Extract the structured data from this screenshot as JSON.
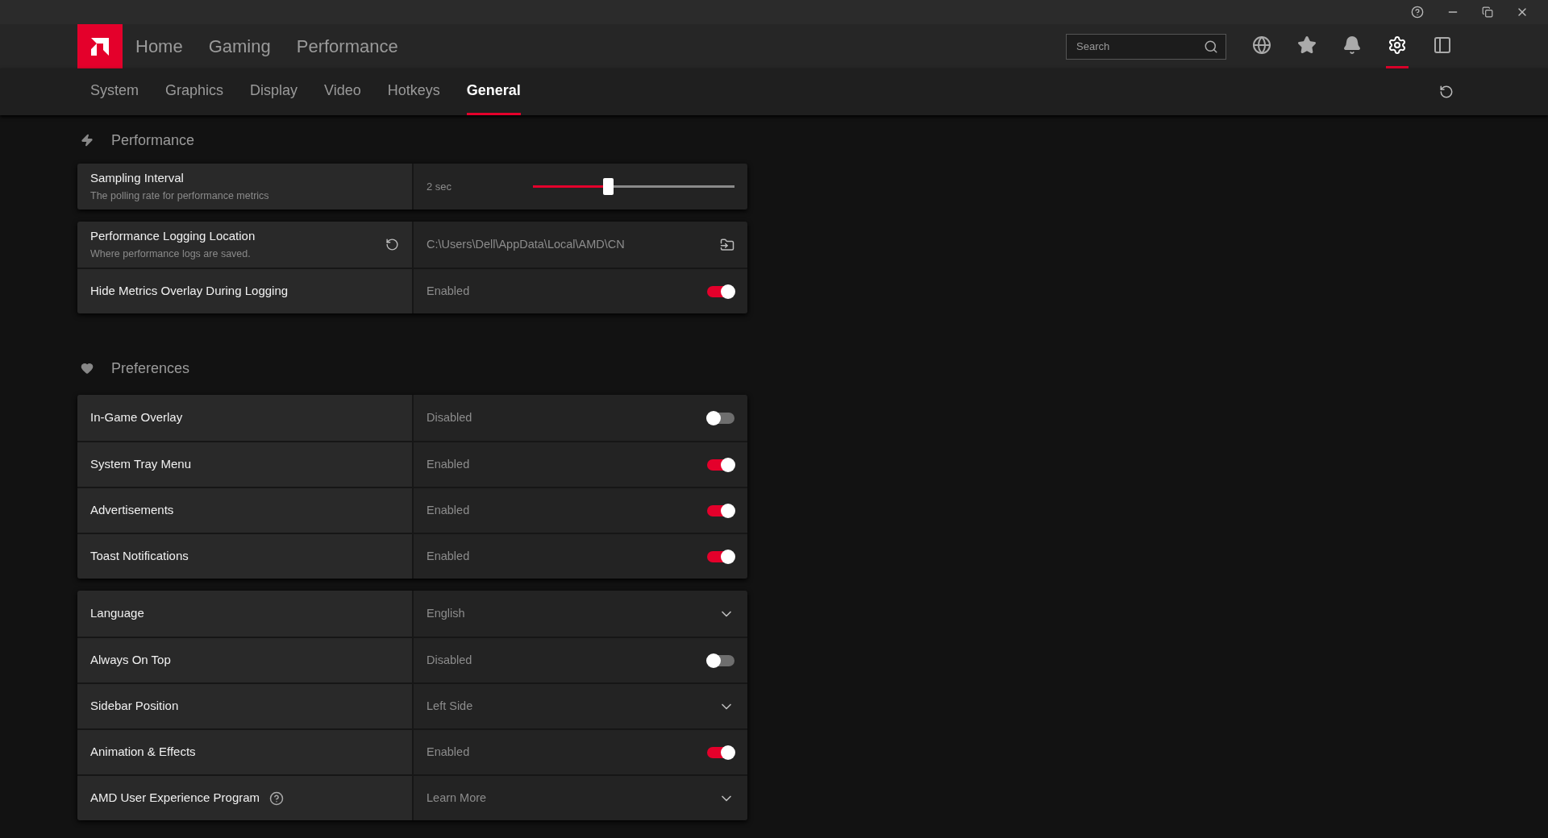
{
  "nav": {
    "items": [
      {
        "label": "Home",
        "selected": false
      },
      {
        "label": "Gaming",
        "selected": false
      },
      {
        "label": "Performance",
        "selected": false
      }
    ],
    "search": {
      "placeholder": "Search"
    },
    "toolbar": [
      {
        "kind": "globe",
        "selected": false
      },
      {
        "kind": "star",
        "selected": false
      },
      {
        "kind": "bell",
        "selected": false
      },
      {
        "kind": "gear",
        "selected": true
      },
      {
        "kind": "panel",
        "selected": false
      }
    ]
  },
  "tabs": [
    {
      "label": "System",
      "selected": false
    },
    {
      "label": "Graphics",
      "selected": false
    },
    {
      "label": "Display",
      "selected": false
    },
    {
      "label": "Video",
      "selected": false
    },
    {
      "label": "Hotkeys",
      "selected": false
    },
    {
      "label": "General",
      "selected": true
    }
  ],
  "sections": [
    {
      "kind": "bolt",
      "title": "Performance",
      "groups": [
        [
          {
            "kind": "slider",
            "label": "Sampling Interval",
            "description": "The polling rate for performance metrics",
            "value": "2 sec",
            "level": 0.37
          }
        ],
        [
          {
            "kind": "path",
            "label": "Performance Logging Location",
            "description": "Where performance logs are saved.",
            "value": "C:\\Users\\Dell\\AppData\\Local\\AMD\\CN"
          },
          {
            "kind": "toggle",
            "label": "Hide Metrics Overlay During Logging",
            "value": "Enabled",
            "on": true
          }
        ]
      ]
    },
    {
      "kind": "heart",
      "title": "Preferences",
      "groups": [
        [
          {
            "kind": "toggle",
            "label": "In-Game Overlay",
            "value": "Disabled",
            "on": false
          },
          {
            "kind": "toggle",
            "label": "System Tray Menu",
            "value": "Enabled",
            "on": true
          },
          {
            "kind": "toggle",
            "label": "Advertisements",
            "value": "Enabled",
            "on": true
          },
          {
            "kind": "toggle",
            "label": "Toast Notifications",
            "value": "Enabled",
            "on": true
          }
        ],
        [
          {
            "kind": "dropdown",
            "label": "Language",
            "value": "English"
          },
          {
            "kind": "toggle",
            "label": "Always On Top",
            "value": "Disabled",
            "on": false
          },
          {
            "kind": "dropdown",
            "label": "Sidebar Position",
            "value": "Left Side"
          },
          {
            "kind": "toggle",
            "label": "Animation & Effects",
            "value": "Enabled",
            "on": true
          },
          {
            "kind": "dropdown",
            "label": "AMD User Experience Program",
            "value": "Learn More",
            "help": true
          }
        ]
      ]
    }
  ]
}
